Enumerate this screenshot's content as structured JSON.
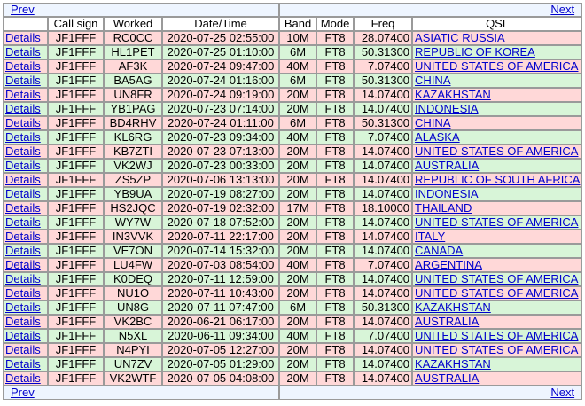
{
  "nav": {
    "prev": "Prev",
    "next": "Next"
  },
  "headers": [
    "",
    "Call sign",
    "Worked",
    "Date/Time",
    "Band",
    "Mode",
    "Freq",
    "QSL"
  ],
  "details_label": "Details",
  "colors": {
    "pink": "#ffd8d8",
    "green": "#d8f5d8",
    "link": "#0000cc"
  },
  "rows": [
    {
      "call": "JF1FFF",
      "worked": "RC0CC",
      "datetime": "2020-07-25 02:55:00",
      "band": "10M",
      "mode": "FT8",
      "freq": "28.07400",
      "qsl": "ASIATIC RUSSIA",
      "color": "pink"
    },
    {
      "call": "JF1FFF",
      "worked": "HL1PET",
      "datetime": "2020-07-25 01:10:00",
      "band": "6M",
      "mode": "FT8",
      "freq": "50.31300",
      "qsl": "REPUBLIC OF KOREA",
      "color": "green"
    },
    {
      "call": "JF1FFF",
      "worked": "AF3K",
      "datetime": "2020-07-24 09:47:00",
      "band": "40M",
      "mode": "FT8",
      "freq": "7.07400",
      "qsl": "UNITED STATES OF AMERICA",
      "color": "pink"
    },
    {
      "call": "JF1FFF",
      "worked": "BA5AG",
      "datetime": "2020-07-24 01:16:00",
      "band": "6M",
      "mode": "FT8",
      "freq": "50.31300",
      "qsl": "CHINA",
      "color": "green"
    },
    {
      "call": "JF1FFF",
      "worked": "UN8FR",
      "datetime": "2020-07-24 09:19:00",
      "band": "20M",
      "mode": "FT8",
      "freq": "14.07400",
      "qsl": "KAZAKHSTAN",
      "color": "pink"
    },
    {
      "call": "JF1FFF",
      "worked": "YB1PAG",
      "datetime": "2020-07-23 07:14:00",
      "band": "20M",
      "mode": "FT8",
      "freq": "14.07400",
      "qsl": "INDONESIA",
      "color": "green"
    },
    {
      "call": "JF1FFF",
      "worked": "BD4RHV",
      "datetime": "2020-07-24 01:11:00",
      "band": "6M",
      "mode": "FT8",
      "freq": "50.31300",
      "qsl": "CHINA",
      "color": "pink"
    },
    {
      "call": "JF1FFF",
      "worked": "KL6RG",
      "datetime": "2020-07-23 09:34:00",
      "band": "40M",
      "mode": "FT8",
      "freq": "7.07400",
      "qsl": "ALASKA",
      "color": "green"
    },
    {
      "call": "JF1FFF",
      "worked": "KB7ZTI",
      "datetime": "2020-07-23 07:13:00",
      "band": "20M",
      "mode": "FT8",
      "freq": "14.07400",
      "qsl": "UNITED STATES OF AMERICA",
      "color": "pink"
    },
    {
      "call": "JF1FFF",
      "worked": "VK2WJ",
      "datetime": "2020-07-23 00:33:00",
      "band": "20M",
      "mode": "FT8",
      "freq": "14.07400",
      "qsl": "AUSTRALIA",
      "color": "green"
    },
    {
      "call": "JF1FFF",
      "worked": "ZS5ZP",
      "datetime": "2020-07-06 13:13:00",
      "band": "20M",
      "mode": "FT8",
      "freq": "14.07400",
      "qsl": "REPUBLIC OF SOUTH AFRICA",
      "color": "pink"
    },
    {
      "call": "JF1FFF",
      "worked": "YB9UA",
      "datetime": "2020-07-19 08:27:00",
      "band": "20M",
      "mode": "FT8",
      "freq": "14.07400",
      "qsl": "INDONESIA",
      "color": "green"
    },
    {
      "call": "JF1FFF",
      "worked": "HS2JQC",
      "datetime": "2020-07-19 02:32:00",
      "band": "17M",
      "mode": "FT8",
      "freq": "18.10000",
      "qsl": "THAILAND",
      "color": "pink"
    },
    {
      "call": "JF1FFF",
      "worked": "WY7W",
      "datetime": "2020-07-18 07:52:00",
      "band": "20M",
      "mode": "FT8",
      "freq": "14.07400",
      "qsl": "UNITED STATES OF AMERICA",
      "color": "green"
    },
    {
      "call": "JF1FFF",
      "worked": "IN3VVK",
      "datetime": "2020-07-11 22:17:00",
      "band": "20M",
      "mode": "FT8",
      "freq": "14.07400",
      "qsl": "ITALY",
      "color": "pink"
    },
    {
      "call": "JF1FFF",
      "worked": "VE7ON",
      "datetime": "2020-07-14 15:32:00",
      "band": "20M",
      "mode": "FT8",
      "freq": "14.07400",
      "qsl": "CANADA",
      "color": "green"
    },
    {
      "call": "JF1FFF",
      "worked": "LU4FW",
      "datetime": "2020-07-03 08:54:00",
      "band": "40M",
      "mode": "FT8",
      "freq": "7.07400",
      "qsl": "ARGENTINA",
      "color": "pink"
    },
    {
      "call": "JF1FFF",
      "worked": "K0DEQ",
      "datetime": "2020-07-11 12:59:00",
      "band": "20M",
      "mode": "FT8",
      "freq": "14.07400",
      "qsl": "UNITED STATES OF AMERICA",
      "color": "green"
    },
    {
      "call": "JF1FFF",
      "worked": "NU1O",
      "datetime": "2020-07-11 10:43:00",
      "band": "20M",
      "mode": "FT8",
      "freq": "14.07400",
      "qsl": "UNITED STATES OF AMERICA",
      "color": "pink"
    },
    {
      "call": "JF1FFF",
      "worked": "UN8G",
      "datetime": "2020-07-11 07:47:00",
      "band": "6M",
      "mode": "FT8",
      "freq": "50.31300",
      "qsl": "KAZAKHSTAN",
      "color": "green"
    },
    {
      "call": "JF1FFF",
      "worked": "VK2BC",
      "datetime": "2020-06-21 06:17:00",
      "band": "20M",
      "mode": "FT8",
      "freq": "14.07400",
      "qsl": "AUSTRALIA",
      "color": "pink"
    },
    {
      "call": "JF1FFF",
      "worked": "N5XL",
      "datetime": "2020-06-11 09:34:00",
      "band": "40M",
      "mode": "FT8",
      "freq": "7.07400",
      "qsl": "UNITED STATES OF AMERICA",
      "color": "green"
    },
    {
      "call": "JF1FFF",
      "worked": "N4PYI",
      "datetime": "2020-07-05 12:27:00",
      "band": "20M",
      "mode": "FT8",
      "freq": "14.07400",
      "qsl": "UNITED STATES OF AMERICA",
      "color": "pink"
    },
    {
      "call": "JF1FFF",
      "worked": "UN7ZV",
      "datetime": "2020-07-05 01:29:00",
      "band": "20M",
      "mode": "FT8",
      "freq": "14.07400",
      "qsl": "KAZAKHSTAN",
      "color": "green"
    },
    {
      "call": "JF1FFF",
      "worked": "VK2WTF",
      "datetime": "2020-07-05 04:08:00",
      "band": "20M",
      "mode": "FT8",
      "freq": "14.07400",
      "qsl": "AUSTRALIA",
      "color": "pink"
    }
  ]
}
